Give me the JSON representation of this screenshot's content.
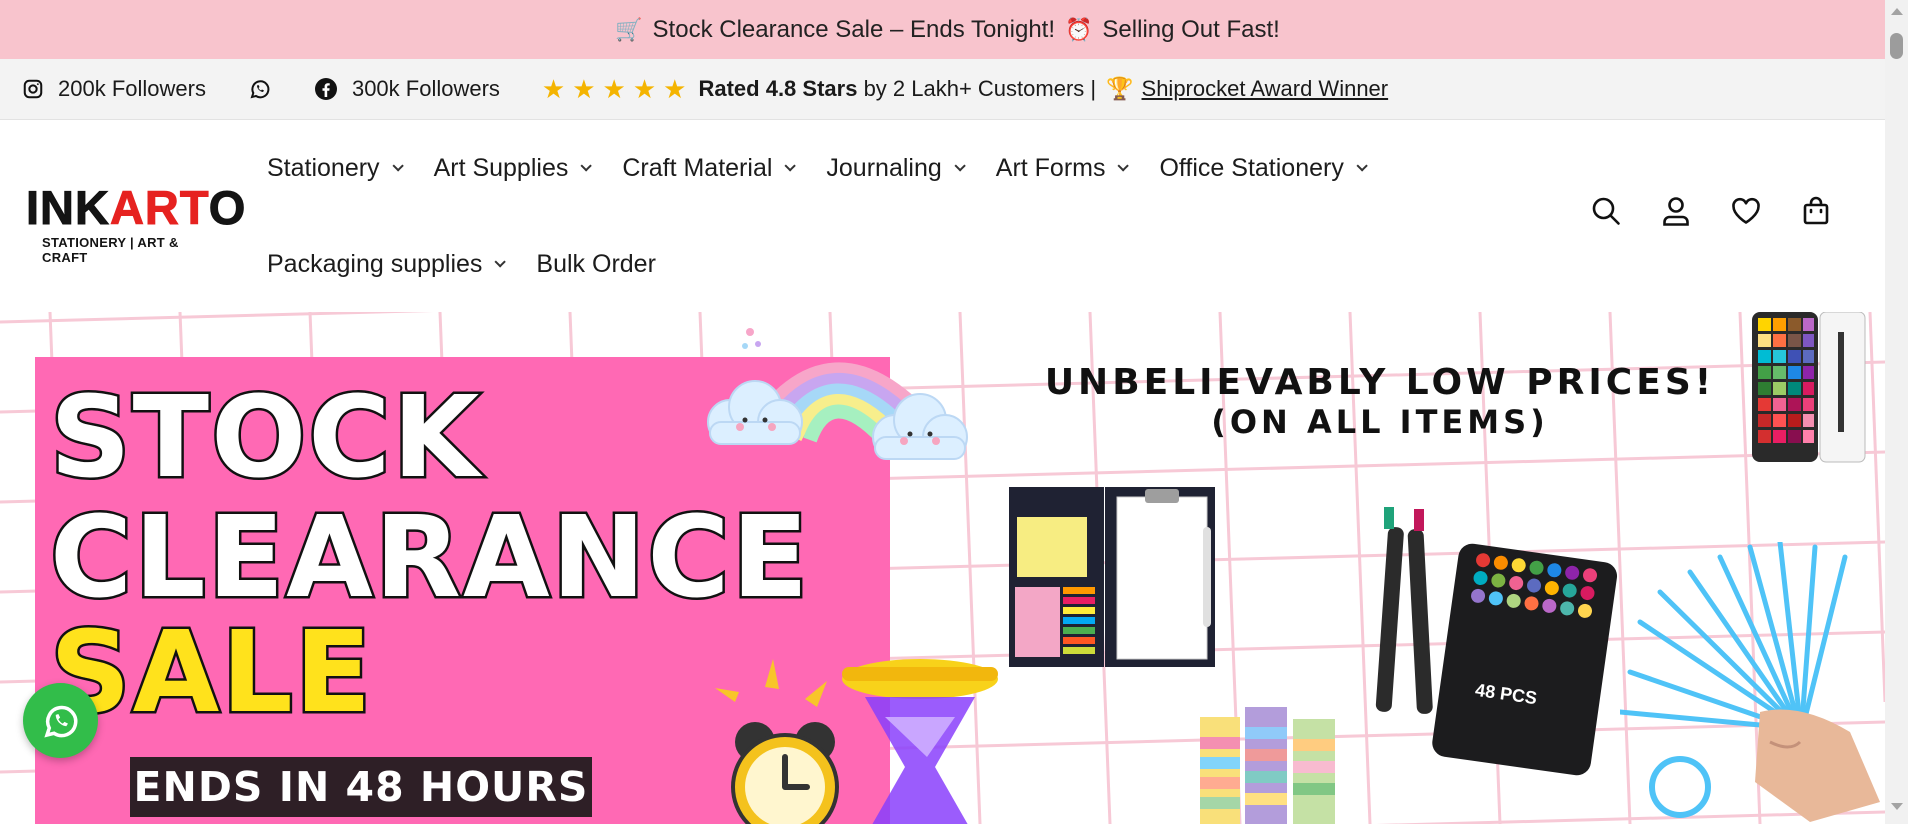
{
  "announcement": {
    "cart_emoji": "🛒",
    "text_before": "Stock Clearance Sale – Ends Tonight!",
    "clock_emoji": "⏰",
    "text_after": "Selling Out Fast!"
  },
  "trust_bar": {
    "instagram_label": "200k Followers",
    "facebook_label": "300k Followers",
    "stars": [
      "★",
      "★",
      "★",
      "★",
      "★"
    ],
    "rated_bold": "Rated 4.8 Stars",
    "rated_rest": "by 2 Lakh+ Customers |",
    "trophy_emoji": "🏆",
    "award_link": "Shiprocket Award Winner"
  },
  "logo": {
    "ink": "INK",
    "art": "ART",
    "o": "O",
    "tagline": "STATIONERY | ART & CRAFT"
  },
  "nav": {
    "row1": [
      {
        "label": "Stationery",
        "dropdown": true
      },
      {
        "label": "Art Supplies",
        "dropdown": true
      },
      {
        "label": "Craft Material",
        "dropdown": true
      },
      {
        "label": "Journaling",
        "dropdown": true
      },
      {
        "label": "Art Forms",
        "dropdown": true
      },
      {
        "label": "Office Stationery",
        "dropdown": true
      }
    ],
    "row2": [
      {
        "label": "Packaging supplies",
        "dropdown": true
      },
      {
        "label": "Bulk Order",
        "dropdown": false
      }
    ]
  },
  "header_icons": [
    "search-icon",
    "account-icon",
    "wishlist-heart-icon",
    "cart-bag-icon"
  ],
  "hero": {
    "line1": "STOCK",
    "line2": "CLEARANCE",
    "line3": "SALE",
    "ends": "ENDS IN 48 HOURS",
    "headline": "UNBELIEVABLY LOW PRICES!",
    "subheadline": "(ON ALL ITEMS)",
    "marker_case_label": "48 PCS",
    "colors": {
      "panel": "#ff69b4",
      "sale_yellow": "#ffe21c",
      "ends_bg": "#2e1f26",
      "grid": "#f7c9d6"
    }
  },
  "colors": {
    "announcement_bg": "#f8c4cd",
    "trust_bg": "#f3f3f3",
    "brand_red": "#e62220",
    "whatsapp_green": "#32bd4a",
    "star": "#f4b400"
  }
}
